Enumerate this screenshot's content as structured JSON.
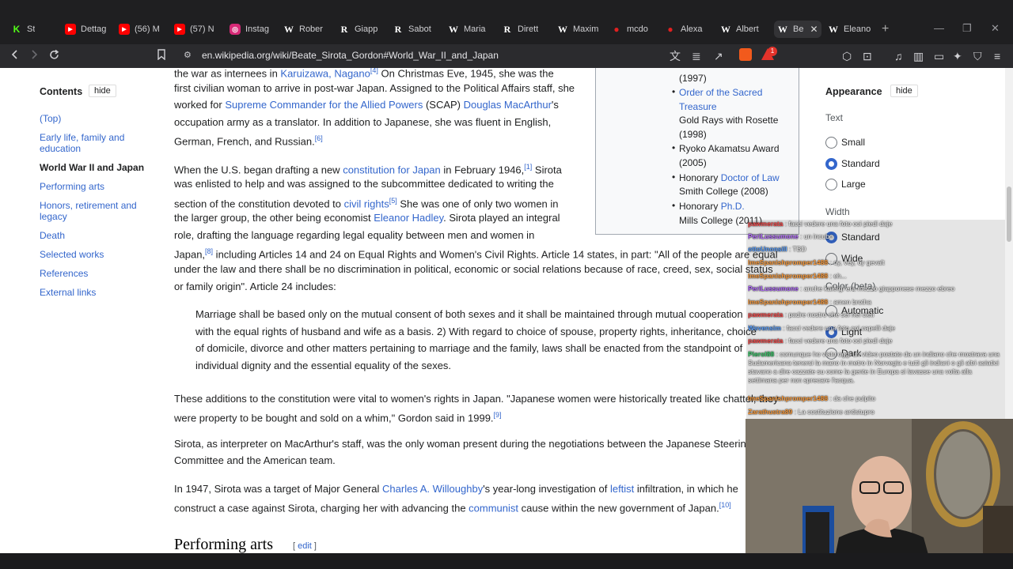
{
  "tabs": [
    {
      "label": "St",
      "icon": "kick-icon",
      "color": "#53fc18"
    },
    {
      "label": "Dettag",
      "icon": "youtube-icon",
      "color": "#ff0000"
    },
    {
      "label": "(56) M",
      "icon": "youtube-icon",
      "color": "#ff0000"
    },
    {
      "label": "(57) N",
      "icon": "youtube-icon",
      "color": "#ff0000"
    },
    {
      "label": "Instag",
      "icon": "instagram-icon",
      "color": "#d62976"
    },
    {
      "label": "Rober",
      "icon": "wikipedia-icon",
      "color": "#ffffff"
    },
    {
      "label": "Giapp",
      "icon": "r-icon",
      "color": "#ffffff"
    },
    {
      "label": "Sabot",
      "icon": "r-icon",
      "color": "#ffffff"
    },
    {
      "label": "Maria",
      "icon": "wikipedia-icon",
      "color": "#ffffff"
    },
    {
      "label": "Dirett",
      "icon": "r-icon",
      "color": "#ffffff"
    },
    {
      "label": "Maxim",
      "icon": "wikipedia-icon",
      "color": "#ffffff"
    },
    {
      "label": "mcdo",
      "icon": "red-circle-icon",
      "color": "#e02020"
    },
    {
      "label": "Alexa",
      "icon": "red-circle-icon",
      "color": "#e02020"
    },
    {
      "label": "Albert",
      "icon": "wikipedia-icon",
      "color": "#ffffff"
    },
    {
      "label": "Be",
      "icon": "wikipedia-icon",
      "color": "#ffffff",
      "active": true
    },
    {
      "label": "Eleano",
      "icon": "wikipedia-icon",
      "color": "#ffffff"
    }
  ],
  "address_bar": {
    "url": "en.wikipedia.org/wiki/Beate_Sirota_Gordon#World_War_II_and_Japan",
    "notification_count": "1"
  },
  "toc": {
    "title": "Contents",
    "hide_label": "hide",
    "items": [
      {
        "label": "(Top)"
      },
      {
        "label": "Early life, family and education"
      },
      {
        "label": "World War II and Japan",
        "current": true
      },
      {
        "label": "Performing arts"
      },
      {
        "label": "Honors, retirement and legacy"
      },
      {
        "label": "Death"
      },
      {
        "label": "Selected works"
      },
      {
        "label": "References"
      },
      {
        "label": "External links"
      }
    ]
  },
  "article": {
    "p1_line1_a": "the war as internees in ",
    "p1_line1_link": "Karuizawa, Nagano",
    "p1_line1_ref": "[4]",
    "p1_line1_b": " On Christmas Eve, 1945, she was the",
    "p1_line2": "first civilian woman to arrive in post-war Japan. Assigned to the Political Affairs staff, she",
    "p1_line3_a": "worked for ",
    "p1_line3_link1": "Supreme Commander for the Allied Powers",
    "p1_line3_b": " (SCAP) ",
    "p1_line3_link2": "Douglas MacArthur",
    "p1_line3_c": "'s",
    "p1_line4": "occupation army as a translator. In addition to Japanese, she was fluent in English,",
    "p1_line5": "German, French, and Russian.",
    "p1_ref6": "[6]",
    "p2_l1_a": "When the U.S. began drafting a new ",
    "p2_l1_link": "constitution for Japan",
    "p2_l1_b": " in February 1946,",
    "p2_l1_ref": "[1]",
    "p2_l1_c": " Sirota",
    "p2_l2": "was enlisted to help and was assigned to the subcommittee dedicated to writing the",
    "p2_l3_a": "section of the constitution devoted to ",
    "p2_l3_link": "civil rights",
    "p2_l3_ref": "[5]",
    "p2_l3_b": " She was one of only two women in",
    "p2_l4_a": "the larger group, the other being economist ",
    "p2_l4_link": "Eleanor Hadley",
    "p2_l4_b": ". Sirota played an integral",
    "p2_l5": "role, drafting the language regarding legal equality between men and women in",
    "p2_l6_a": "Japan,",
    "p2_l6_ref": "[8]",
    "p2_l6_b": " including Articles 14 and 24 on Equal Rights and Women's Civil Rights. Article 14 states, in part: \"All of the people are equal",
    "p2_l7": "under the law and there shall be no discrimination in political, economic or social relations because of race, creed, sex, social status",
    "p2_l8": "or family origin\". Article 24 includes:",
    "q_l1": "Marriage shall be based only on the mutual consent of both sexes and it shall be maintained through mutual cooperation",
    "q_l2": "with the equal rights of husband and wife as a basis. 2) With regard to choice of spouse, property rights, inheritance, choice",
    "q_l3": "of domicile, divorce and other matters pertaining to marriage and the family, laws shall be enacted from the standpoint of",
    "q_l4": "individual dignity and the essential equality of the sexes.",
    "p3_l1": "These additions to the constitution were vital to women's rights in Japan. \"Japanese women were historically treated like chattel; they",
    "p3_l2": "were property to be bought and sold on a whim,\" Gordon said in 1999.",
    "p3_ref": "[9]",
    "p4_l1": "Sirota, as interpreter on MacArthur's staff, was the only woman present during the negotiations between the Japanese Steering",
    "p4_l2": "Committee and the American team.",
    "p5_l1_a": "In 1947, Sirota was a target of Major General ",
    "p5_l1_link1": "Charles A. Willoughby",
    "p5_l1_b": "'s year-long investigation of ",
    "p5_l1_link2": "leftist",
    "p5_l1_c": " infiltration, in which he",
    "p5_l2_a": "construct a case against Sirota, charging her with advancing the ",
    "p5_l2_link": "communist",
    "p5_l2_b": " cause within the new government of Japan.",
    "p5_ref": "[10]",
    "section_title": "Performing arts",
    "edit_label": "edit"
  },
  "infobox": {
    "year1997": "(1997)",
    "order_link": "Order of the Sacred Treasure",
    "gold_rays": "Gold Rays with Rosette (1998)",
    "ryoko": "Ryoko Akamatsu Award (2005)",
    "honorary1_a": "Honorary ",
    "honorary1_link": "Doctor of Law",
    "smith": "Smith College (2008)",
    "honorary2_a": "Honorary ",
    "honorary2_link": "Ph.D.",
    "mills": "Mills College (2011)"
  },
  "appearance": {
    "title": "Appearance",
    "hide_label": "hide",
    "text_label": "Text",
    "text_options": [
      "Small",
      "Standard",
      "Large"
    ],
    "text_selected": "Standard",
    "width_label": "Width",
    "width_options": [
      "Standard",
      "Wide"
    ],
    "color_label": "Color (beta)",
    "color_options": [
      "Automatic",
      "Light",
      "Dark"
    ]
  },
  "chat": [
    {
      "user": "pawmerata",
      "color": "#ff4d4d",
      "text": ": facci vedere una foto coi piedi daje"
    },
    {
      "user": "PeriLussumone",
      "color": "#b36bff",
      "text": ": un incubo"
    },
    {
      "user": "ottoUnonsill",
      "color": "#5aa0ff",
      "text": ": TBD"
    },
    {
      "user": "ImeSpanishpromper1488",
      "color": "#ff9e3d",
      "text": ": oy, vey, oy gevalt"
    },
    {
      "user": "ImeSpanishpromper1488",
      "color": "#ff9e3d",
      "text": ": eh..."
    },
    {
      "user": "PeriLussumone",
      "color": "#b36bff",
      "text": ": anche kalergi era mezzo giapponese mezzo ebreo"
    },
    {
      "user": "ImeSpanishpromper1488",
      "color": "#ff9e3d",
      "text": ": amen brotha"
    },
    {
      "user": "pawmerata",
      "color": "#ff4d4d",
      "text": ": padre nostro che sei nei cieli"
    },
    {
      "user": "Wevensim",
      "color": "#5aa0ff",
      "text": ": facci vedere una foto coi capelli daje"
    },
    {
      "user": "pawmerata",
      "color": "#ff4d4d",
      "text": ": facci vedere una foto coi piedi daje"
    },
    {
      "user": "Pierol88",
      "color": "#3ecf6e",
      "text": ": comunque ho visto oggi un video postato da un indiano che mostrava una Sudamericana tenersi la mano in metro in Norvegia e tutti gli indiani o gli altri asiatici stavano a dire cazzate su come la gente in Europa si lavasse una volta alla settimana per non sprecare l'acqua."
    },
    {
      "user": "ImeSpanishpromper1488",
      "color": "#ff9e3d",
      "text": ": da che pulpito"
    },
    {
      "user": "Zarathustra89",
      "color": "#ff9e3d",
      "text": ": La costituzione antistupro"
    }
  ]
}
